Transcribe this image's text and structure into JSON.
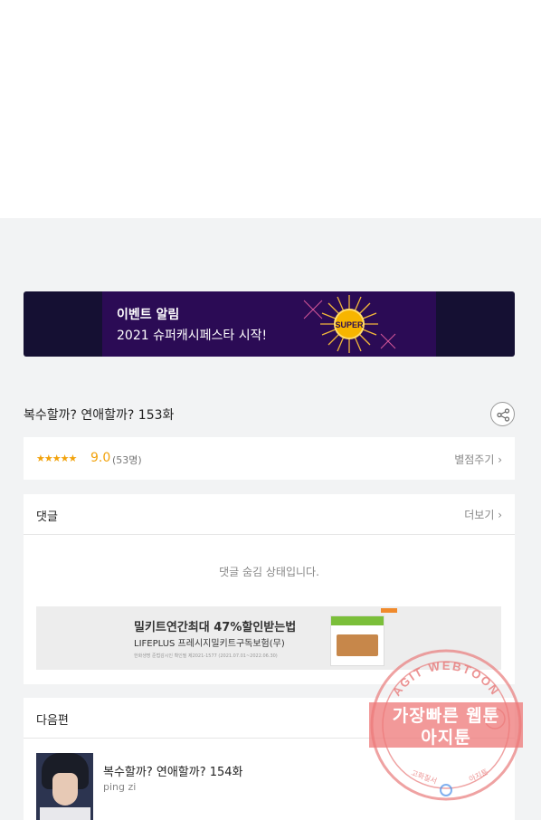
{
  "banner": {
    "title": "이벤트 알림",
    "subtitle": "2021 슈퍼캐시페스타 시작!",
    "badge": "SUPER"
  },
  "episode": {
    "title": "복수할까? 연애할까? 153화",
    "share_icon": "share-icon"
  },
  "rating": {
    "stars": "★★★★★",
    "score": "9.0",
    "count": "(53명)",
    "rate_label": "별점주기 ›"
  },
  "comments": {
    "header": "댓글",
    "more_label": "더보기 ›",
    "hidden_message": "댓글 숨김 상태입니다."
  },
  "ad": {
    "title": "밀키트연간최대 47%할인받는법",
    "subtitle": "LIFEPLUS 프레시지밀키트구독보험(무)",
    "fine_print": "한화생명 준법감시인 확인필 제2021-1577 (2021.07.01~2022.06.30)"
  },
  "next": {
    "header": "다음편",
    "title": "복수할까? 연애할까? 154화",
    "author": "ping zi"
  },
  "watermark": {
    "top_arc": "AGIT WEBTOON",
    "line1": "가장빠른 웹툰",
    "line2": "아지툰",
    "bottom_left": "고화질서",
    "bottom_right": "아지툰"
  }
}
